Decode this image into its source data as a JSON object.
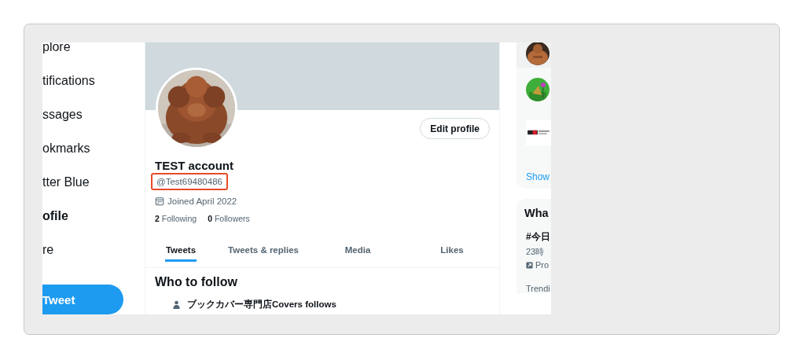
{
  "sidebar": {
    "items": [
      {
        "label": "plore",
        "selected": false
      },
      {
        "label": "tifications",
        "selected": false
      },
      {
        "label": "ssages",
        "selected": false
      },
      {
        "label": "okmarks",
        "selected": false
      },
      {
        "label": "tter Blue",
        "selected": false
      },
      {
        "label": "ofile",
        "selected": true
      },
      {
        "label": "re",
        "selected": false
      }
    ],
    "tweet_button": "Tweet"
  },
  "profile": {
    "edit_button": "Edit profile",
    "name": "TEST account",
    "handle": {
      "text": "@Test69480486",
      "highlighted": true
    },
    "joined": "Joined April 2022",
    "stats": [
      {
        "count": "2",
        "label": "Following"
      },
      {
        "count": "0",
        "label": "Followers"
      }
    ]
  },
  "tabs": [
    {
      "label": "Tweets",
      "selected": true
    },
    {
      "label": "Tweets & replies",
      "selected": false
    },
    {
      "label": "Media",
      "selected": false
    },
    {
      "label": "Likes",
      "selected": false
    }
  ],
  "who_to_follow": {
    "title": "Who to follow",
    "context": "ブックカバー専門店Covers follows"
  },
  "right_column": {
    "suggestions": [
      {
        "kind": "avatar"
      },
      {
        "kind": "avatar"
      },
      {
        "kind": "logo"
      }
    ],
    "show_link": "Show",
    "trends": {
      "title": "Wha",
      "items": [
        {
          "kind": "promoted",
          "title": "#今日",
          "meta": "23時",
          "promo": "Pro"
        },
        {
          "kind": "label",
          "category": "Trendi"
        }
      ]
    }
  }
}
